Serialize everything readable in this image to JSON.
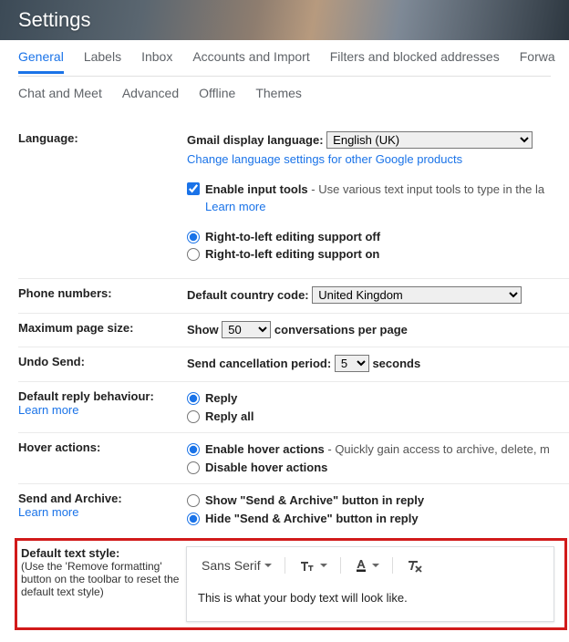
{
  "header": {
    "title": "Settings"
  },
  "tabs": {
    "row1": [
      "General",
      "Labels",
      "Inbox",
      "Accounts and Import",
      "Filters and blocked addresses",
      "Forwa"
    ],
    "row2": [
      "Chat and Meet",
      "Advanced",
      "Offline",
      "Themes"
    ],
    "active": "General"
  },
  "language": {
    "label": "Language:",
    "display_label": "Gmail display language:",
    "display_value": "English (UK)",
    "change_link": "Change language settings for other Google products",
    "enable_tools_label": "Enable input tools",
    "enable_tools_desc": " - Use various text input tools to type in the la",
    "learn_more": "Learn more",
    "rtl_off": "Right-to-left editing support off",
    "rtl_on": "Right-to-left editing support on"
  },
  "phone": {
    "label": "Phone numbers:",
    "code_label": "Default country code:",
    "code_value": "United Kingdom"
  },
  "pagesize": {
    "label": "Maximum page size:",
    "show": "Show",
    "value": "50",
    "suffix": "conversations per page"
  },
  "undo": {
    "label": "Undo Send:",
    "prefix": "Send cancellation period:",
    "value": "5",
    "suffix": "seconds"
  },
  "reply": {
    "label": "Default reply behaviour:",
    "learn_more": "Learn more",
    "opt1": "Reply",
    "opt2": "Reply all"
  },
  "hover": {
    "label": "Hover actions:",
    "opt1": "Enable hover actions",
    "opt1_desc": " - Quickly gain access to archive, delete, m",
    "opt2": "Disable hover actions"
  },
  "sendarchive": {
    "label": "Send and Archive:",
    "learn_more": "Learn more",
    "opt1": "Show \"Send & Archive\" button in reply",
    "opt2": "Hide \"Send & Archive\" button in reply"
  },
  "textstyle": {
    "label": "Default text style:",
    "sub": "(Use the 'Remove formatting' button on the toolbar to reset the default text style)",
    "font_name": "Sans Serif",
    "sample": "This is what your body text will look like."
  }
}
